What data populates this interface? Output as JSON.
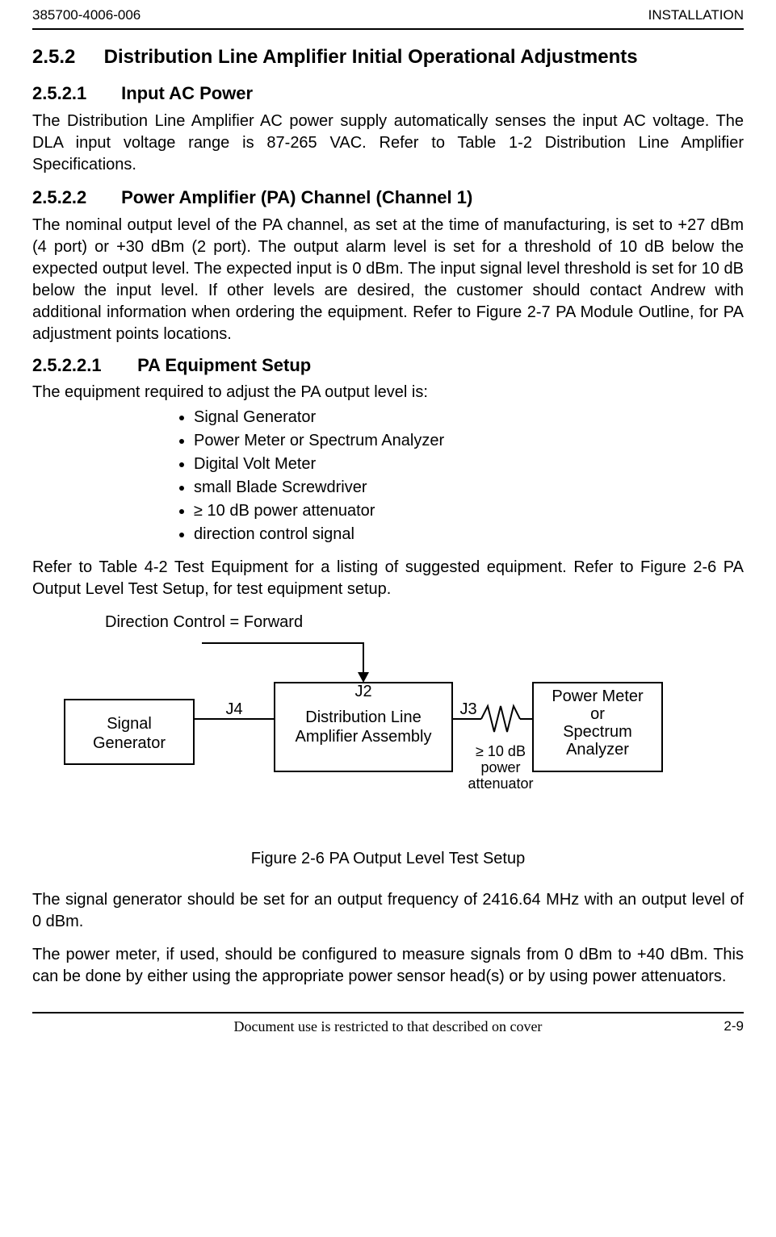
{
  "header": {
    "docnum": "385700-4006-006",
    "section_label": "INSTALLATION"
  },
  "h252": {
    "num": "2.5.2",
    "title": "Distribution Line Amplifier Initial Operational Adjustments"
  },
  "h2521": {
    "num": "2.5.2.1",
    "title": "Input AC Power",
    "para": "The Distribution Line Amplifier AC power supply automatically senses the input AC voltage. The DLA input voltage range is 87-265 VAC.  Refer to Table 1-2  Distribution Line Amplifier Specifications."
  },
  "h2522": {
    "num": "2.5.2.2",
    "title": "Power Amplifier (PA) Channel  (Channel 1)",
    "para": "The nominal output level of the PA channel, as set at the time of manufacturing, is set to +27 dBm (4 port) or +30 dBm (2 port).  The output alarm level is set for a threshold of 10 dB below the expected output level.  The expected input is 0 dBm.  The input signal level threshold is set for 10 dB below the input level.  If other levels are desired, the customer should contact Andrew with additional information when ordering the equipment.  Refer to Figure 2-7  PA Module Outline, for PA adjustment points locations."
  },
  "h25221": {
    "num": "2.5.2.2.1",
    "title": "PA Equipment Setup",
    "intro": "The equipment required to adjust the PA output level is:",
    "bullets": [
      "Signal Generator",
      "Power Meter or Spectrum Analyzer",
      "Digital Volt Meter",
      "small Blade Screwdriver",
      "≥ 10 dB power attenuator",
      "direction control signal"
    ],
    "post": "Refer to Table 4-2  Test Equipment for a listing of suggested equipment.  Refer to Figure 2-6  PA Output Level Test Setup, for test equipment setup."
  },
  "figure": {
    "dir_ctrl": "Direction Control = Forward",
    "siggen": "Signal\nGenerator",
    "dla_l1": "Distribution Line",
    "dla_l2": "Amplifier Assembly",
    "pm_l1": "Power Meter",
    "pm_l2": "or",
    "pm_l3": "Spectrum",
    "pm_l4": "Analyzer",
    "j2": "J2",
    "j3": "J3",
    "j4": "J4",
    "att_l1": "≥ 10 dB",
    "att_l2": "power",
    "att_l3": "attenuator",
    "caption": "Figure 2-6  PA Output Level Test Setup"
  },
  "after_fig": {
    "p1": "The signal generator should be set for an output frequency of 2416.64 MHz with an output level of 0 dBm.",
    "p2": "The power meter, if used, should be configured to measure signals from 0 dBm to +40 dBm. This can be done by either using the appropriate power sensor head(s) or by using power attenuators."
  },
  "footer": {
    "center": "Document use is restricted to that described on cover",
    "page": "2-9"
  }
}
